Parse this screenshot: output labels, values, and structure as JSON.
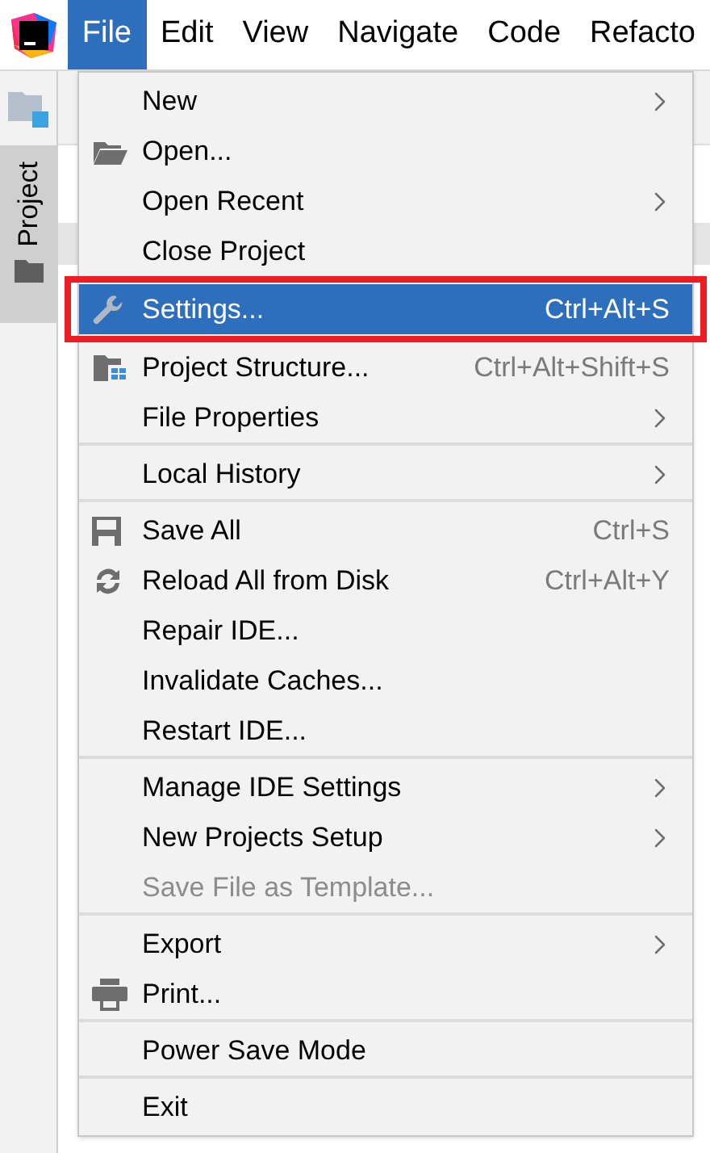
{
  "menu_bar": [
    {
      "label": "File",
      "selected": true
    },
    {
      "label": "Edit",
      "selected": false
    },
    {
      "label": "View",
      "selected": false
    },
    {
      "label": "Navigate",
      "selected": false
    },
    {
      "label": "Code",
      "selected": false
    },
    {
      "label": "Refacto",
      "selected": false
    }
  ],
  "side_tab": {
    "label": "Project"
  },
  "file_menu": {
    "groups": [
      [
        {
          "label": "New",
          "kind": "plain",
          "submenu": true,
          "selected": false,
          "disabled": false,
          "highlighted": false
        },
        {
          "label": "Open...",
          "kind": "open",
          "submenu": false,
          "selected": false,
          "disabled": false,
          "highlighted": false
        },
        {
          "label": "Open Recent",
          "kind": "plain",
          "submenu": true,
          "selected": false,
          "disabled": false,
          "highlighted": false
        },
        {
          "label": "Close Project",
          "kind": "plain",
          "submenu": false,
          "selected": false,
          "disabled": false,
          "highlighted": false
        },
        {
          "label": "Settings...",
          "kind": "settings",
          "shortcut": "Ctrl+Alt+S",
          "submenu": false,
          "selected": true,
          "disabled": false,
          "highlighted": true
        },
        {
          "label": "Project Structure...",
          "kind": "structure",
          "shortcut": "Ctrl+Alt+Shift+S",
          "submenu": false,
          "selected": false,
          "disabled": false,
          "highlighted": false
        },
        {
          "label": "File Properties",
          "kind": "plain",
          "submenu": true,
          "selected": false,
          "disabled": false,
          "highlighted": false
        }
      ],
      [
        {
          "label": "Local History",
          "kind": "plain",
          "submenu": true,
          "selected": false,
          "disabled": false,
          "highlighted": false
        }
      ],
      [
        {
          "label": "Save All",
          "kind": "save",
          "shortcut": "Ctrl+S",
          "submenu": false,
          "selected": false,
          "disabled": false,
          "highlighted": false
        },
        {
          "label": "Reload All from Disk",
          "kind": "reload",
          "shortcut": "Ctrl+Alt+Y",
          "submenu": false,
          "selected": false,
          "disabled": false,
          "highlighted": false
        },
        {
          "label": "Repair IDE...",
          "kind": "plain",
          "submenu": false,
          "selected": false,
          "disabled": false,
          "highlighted": false
        },
        {
          "label": "Invalidate Caches...",
          "kind": "plain",
          "submenu": false,
          "selected": false,
          "disabled": false,
          "highlighted": false
        },
        {
          "label": "Restart IDE...",
          "kind": "plain",
          "submenu": false,
          "selected": false,
          "disabled": false,
          "highlighted": false
        }
      ],
      [
        {
          "label": "Manage IDE Settings",
          "kind": "plain",
          "submenu": true,
          "selected": false,
          "disabled": false,
          "highlighted": false
        },
        {
          "label": "New Projects Setup",
          "kind": "plain",
          "submenu": true,
          "selected": false,
          "disabled": false,
          "highlighted": false
        },
        {
          "label": "Save File as Template...",
          "kind": "plain",
          "submenu": false,
          "selected": false,
          "disabled": true,
          "highlighted": false
        }
      ],
      [
        {
          "label": "Export",
          "kind": "plain",
          "submenu": true,
          "selected": false,
          "disabled": false,
          "highlighted": false
        },
        {
          "label": "Print...",
          "kind": "print",
          "submenu": false,
          "selected": false,
          "disabled": false,
          "highlighted": false
        }
      ],
      [
        {
          "label": "Power Save Mode",
          "kind": "plain",
          "submenu": false,
          "selected": false,
          "disabled": false,
          "highlighted": false
        }
      ],
      [
        {
          "label": "Exit",
          "kind": "plain",
          "submenu": false,
          "selected": false,
          "disabled": false,
          "highlighted": false
        }
      ]
    ]
  }
}
